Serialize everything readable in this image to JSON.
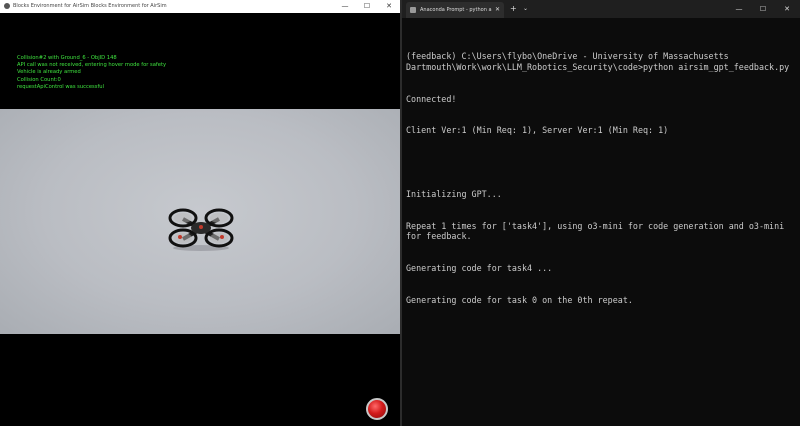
{
  "left_window": {
    "title": "Blocks Environment for AirSim Blocks Environment for AirSim",
    "controls": {
      "minimize": "—",
      "maximize": "☐",
      "close": "✕"
    },
    "hud_messages": [
      "Collision#2 with Ground_6 - ObjID 148",
      "API call was not received, entering hover mode for safety",
      "Vehicle is already armed",
      "Collision Count:0",
      "requestApiControl was successful"
    ],
    "hud_color": "#3fe43f",
    "record_button_icon": "record-icon"
  },
  "right_window": {
    "tab_title": "Anaconda Prompt - python  a",
    "tab_close": "✕",
    "new_tab": "+",
    "tab_dropdown": "⌄",
    "controls": {
      "minimize": "—",
      "maximize": "☐",
      "close": "✕"
    },
    "terminal_lines": [
      "(feedback) C:\\Users\\flybo\\OneDrive - University of Massachusetts Dartmouth\\Work\\work\\LLM_Robotics_Security\\code>python airsim_gpt_feedback.py",
      "Connected!",
      "Client Ver:1 (Min Req: 1), Server Ver:1 (Min Req: 1)",
      "",
      "Initializing GPT...",
      "Repeat 1 times for ['task4'], using o3-mini for code generation and o3-mini for feedback.",
      "Generating code for task4 ...",
      "Generating code for task 0 on the 0th repeat."
    ]
  }
}
